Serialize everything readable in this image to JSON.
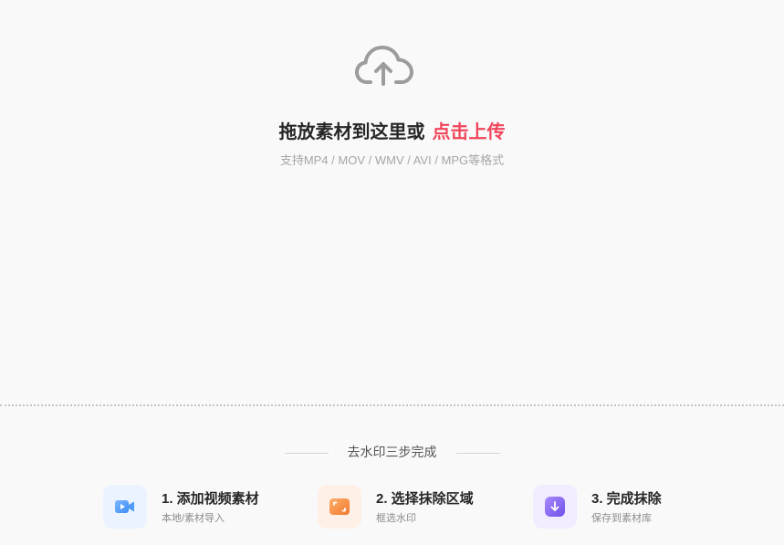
{
  "upload": {
    "icon": "cloud-upload-icon",
    "title_prefix": "拖放素材到这里或",
    "title_link": "点击上传",
    "hint": "支持MP4 / MOV / WMV / AVI / MPG等格式",
    "link_color": "#f0455a"
  },
  "steps": {
    "heading": "去水印三步完成",
    "items": [
      {
        "title": "1. 添加视频素材",
        "subtitle": "本地/素材导入",
        "icon": "video-camera-icon",
        "color": "#4f9cf7"
      },
      {
        "title": "2. 选择抹除区域",
        "subtitle": "框选水印",
        "icon": "crop-frame-icon",
        "color": "#f5863d"
      },
      {
        "title": "3. 完成抹除",
        "subtitle": "保存到素材库",
        "icon": "download-arrow-icon",
        "color": "#8b6cf0"
      }
    ]
  }
}
